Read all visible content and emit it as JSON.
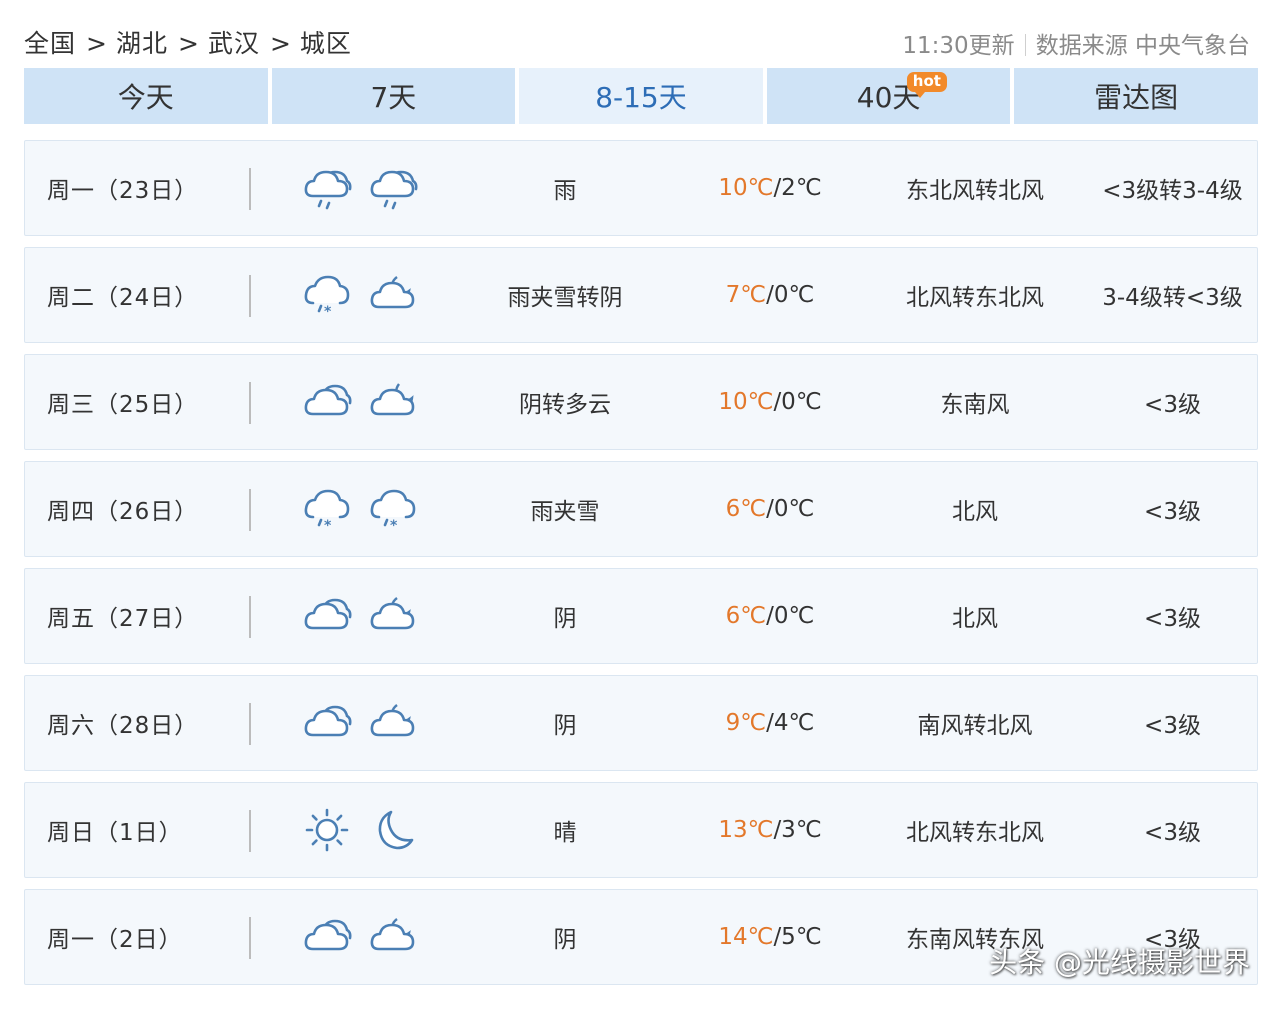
{
  "breadcrumb": [
    "全国",
    "湖北",
    "武汉",
    "城区"
  ],
  "breadcrumb_sep": ">",
  "update": {
    "time_text": "11:30更新",
    "source_text": "数据来源 中央气象台"
  },
  "tabs": [
    {
      "label": "今天"
    },
    {
      "label": "7天"
    },
    {
      "label": "8-15天",
      "active": true
    },
    {
      "label": "40天",
      "badge": "hot"
    },
    {
      "label": "雷达图"
    }
  ],
  "days": [
    {
      "date": "周一（23日）",
      "day_icon": "cloud-rain-icon",
      "night_icon": "cloud-rain-icon",
      "desc": "雨",
      "hi": "10℃",
      "lo": "/2℃",
      "wind": "东北风转北风",
      "level": "<3级转3-4级"
    },
    {
      "date": "周二（24日）",
      "day_icon": "cloud-sleet-icon",
      "night_icon": "moon-cloud-icon",
      "desc": "雨夹雪转阴",
      "hi": "7℃",
      "lo": "/0℃",
      "wind": "北风转东北风",
      "level": "3-4级转<3级"
    },
    {
      "date": "周三（25日）",
      "day_icon": "cloud-icon",
      "night_icon": "moon-cloud-outline-icon",
      "desc": "阴转多云",
      "hi": "10℃",
      "lo": "/0℃",
      "wind": "东南风",
      "level": "<3级"
    },
    {
      "date": "周四（26日）",
      "day_icon": "cloud-sleet-icon",
      "night_icon": "cloud-sleet-icon",
      "desc": "雨夹雪",
      "hi": "6℃",
      "lo": "/0℃",
      "wind": "北风",
      "level": "<3级"
    },
    {
      "date": "周五（27日）",
      "day_icon": "cloud-icon",
      "night_icon": "moon-cloud-icon",
      "desc": "阴",
      "hi": "6℃",
      "lo": "/0℃",
      "wind": "北风",
      "level": "<3级"
    },
    {
      "date": "周六（28日）",
      "day_icon": "cloud-icon",
      "night_icon": "moon-cloud-icon",
      "desc": "阴",
      "hi": "9℃",
      "lo": "/4℃",
      "wind": "南风转北风",
      "level": "<3级"
    },
    {
      "date": "周日（1日）",
      "day_icon": "sun-icon",
      "night_icon": "moon-icon",
      "desc": "晴",
      "hi": "13℃",
      "lo": "/3℃",
      "wind": "北风转东北风",
      "level": "<3级"
    },
    {
      "date": "周一（2日）",
      "day_icon": "cloud-icon",
      "night_icon": "moon-cloud-icon",
      "desc": "阴",
      "hi": "14℃",
      "lo": "/5℃",
      "wind": "东南风转东风",
      "level": "<3级"
    }
  ],
  "watermark": "头条 @光线摄影世界",
  "colors": {
    "tab_bg": "#cfe3f6",
    "tab_active_bg": "#e7f1fb",
    "tab_active_text": "#2d6db6",
    "high_temp": "#e3782b",
    "row_bg": "#f4f8fc",
    "icon_stroke": "#4b7fb4"
  }
}
